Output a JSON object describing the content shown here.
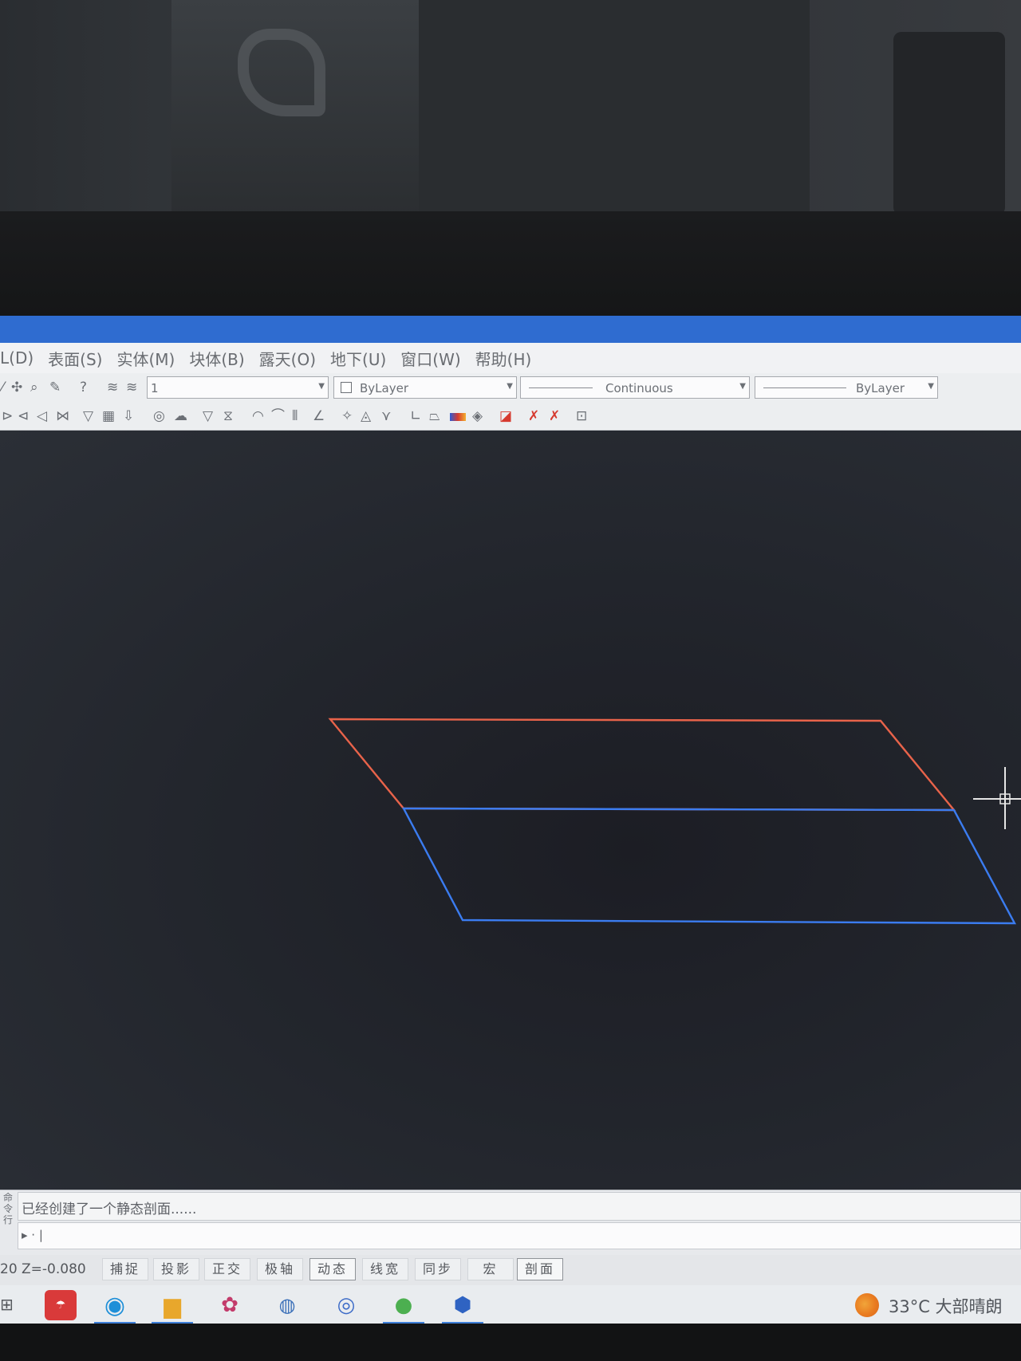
{
  "menu": {
    "items": [
      "L(D)",
      "表面(S)",
      "实体(M)",
      "块体(B)",
      "露天(O)",
      "地下(U)",
      "窗口(W)",
      "帮助(H)"
    ]
  },
  "toolbar": {
    "layer_value": "1",
    "color_value": "ByLayer",
    "linetype_value": "Continuous",
    "lineweight_value": "ByLayer"
  },
  "command": {
    "history_text": "已经创建了一个静态剖面......",
    "prompt_text": "▸ · |"
  },
  "status": {
    "coordinates": "20 Z=-0.080",
    "buttons": [
      {
        "label": "捕捉",
        "on": false
      },
      {
        "label": "投影",
        "on": false
      },
      {
        "label": "正交",
        "on": false
      },
      {
        "label": "极轴",
        "on": false
      },
      {
        "label": "动态",
        "on": true
      },
      {
        "label": "线宽",
        "on": false
      },
      {
        "label": "同步",
        "on": false
      },
      {
        "label": "宏",
        "on": false
      },
      {
        "label": "剖面",
        "on": true
      }
    ]
  },
  "taskbar": {
    "apps": [
      "app-red-icon",
      "edge-icon",
      "file-explorer-icon",
      "tools-icon",
      "lidar-icon",
      "network-icon",
      "wechat-icon",
      "mining-app-icon"
    ],
    "weather": "33°C  大部晴朗"
  },
  "colors": {
    "upper_outline": "#e8634a",
    "lower_outline": "#3b7cf0",
    "title_bar": "#2f6cd0"
  }
}
